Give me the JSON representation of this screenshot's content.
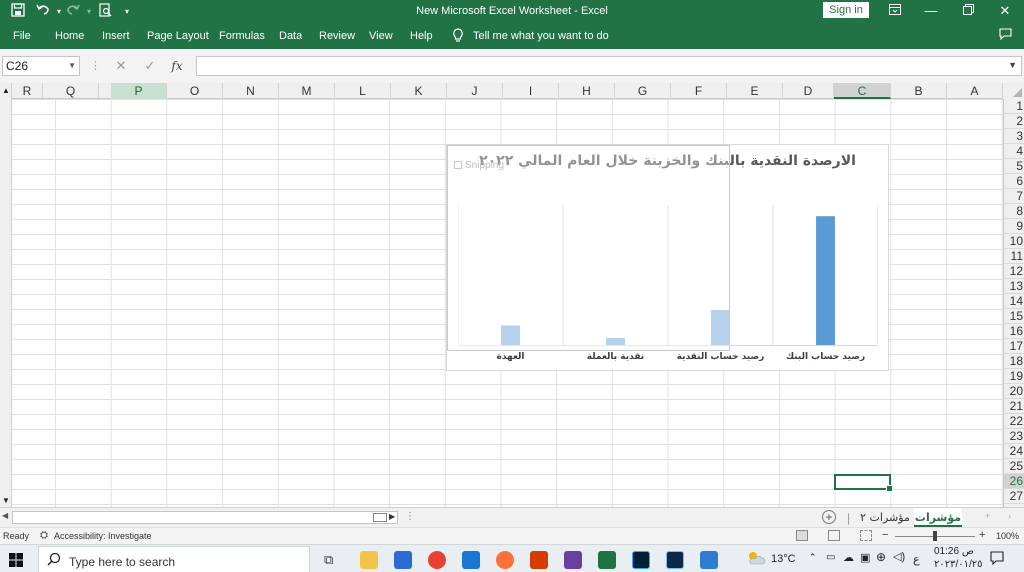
{
  "window": {
    "title": "New Microsoft Excel Worksheet  -  Excel",
    "sign_in": "Sign in"
  },
  "ribbon": {
    "tabs": [
      "File",
      "Home",
      "Insert",
      "Page Layout",
      "Formulas",
      "Data",
      "Review",
      "View",
      "Help"
    ],
    "tell_me": "Tell me what you want to do"
  },
  "formula_bar": {
    "name_box": "C26",
    "fx": "fx",
    "value": ""
  },
  "grid": {
    "columns": [
      "R",
      "Q",
      "P",
      "O",
      "N",
      "M",
      "L",
      "K",
      "J",
      "I",
      "H",
      "G",
      "F",
      "E",
      "D",
      "C",
      "B",
      "A"
    ],
    "rows": [
      "1",
      "2",
      "3",
      "4",
      "5",
      "6",
      "7",
      "8",
      "9",
      "10",
      "11",
      "12",
      "13",
      "14",
      "15",
      "16",
      "17",
      "18",
      "19",
      "20",
      "21",
      "22",
      "23",
      "24",
      "25",
      "26",
      "27"
    ],
    "selected_column": "C",
    "selected_row": "26"
  },
  "chart": {
    "overlay_label": "Snipping"
  },
  "chart_data": {
    "type": "bar",
    "title": "الارصدة النقدية بالبنك والخزينة خلال العام المالي ٢٠٢٢",
    "categories": [
      "رصيد حساب البنك",
      "رصيد حساب النقدية",
      "نقدية بالعملة",
      "العهدة"
    ],
    "values": [
      92,
      25,
      5,
      14
    ],
    "xlabel": "",
    "ylabel": "",
    "ylim": [
      0,
      100
    ],
    "grid": "vertical",
    "axis_direction": "right-to-left",
    "colors": {
      "bar": "#5b9bd5",
      "bar_faded": "#8fb8e0"
    }
  },
  "sheets": {
    "tabs": [
      "مؤشرات",
      "مؤشرات ٢"
    ],
    "active": "مؤشرات"
  },
  "status": {
    "ready": "Ready",
    "accessibility": "Accessibility: Investigate",
    "zoom": "100%"
  },
  "taskbar": {
    "search_placeholder": "Type here to search",
    "weather": "13°C",
    "time": "01:26 ص",
    "date": "٢٠٢٣/٠١/٢٥",
    "lang": "ع"
  },
  "theme": {
    "accent": "#217346"
  }
}
